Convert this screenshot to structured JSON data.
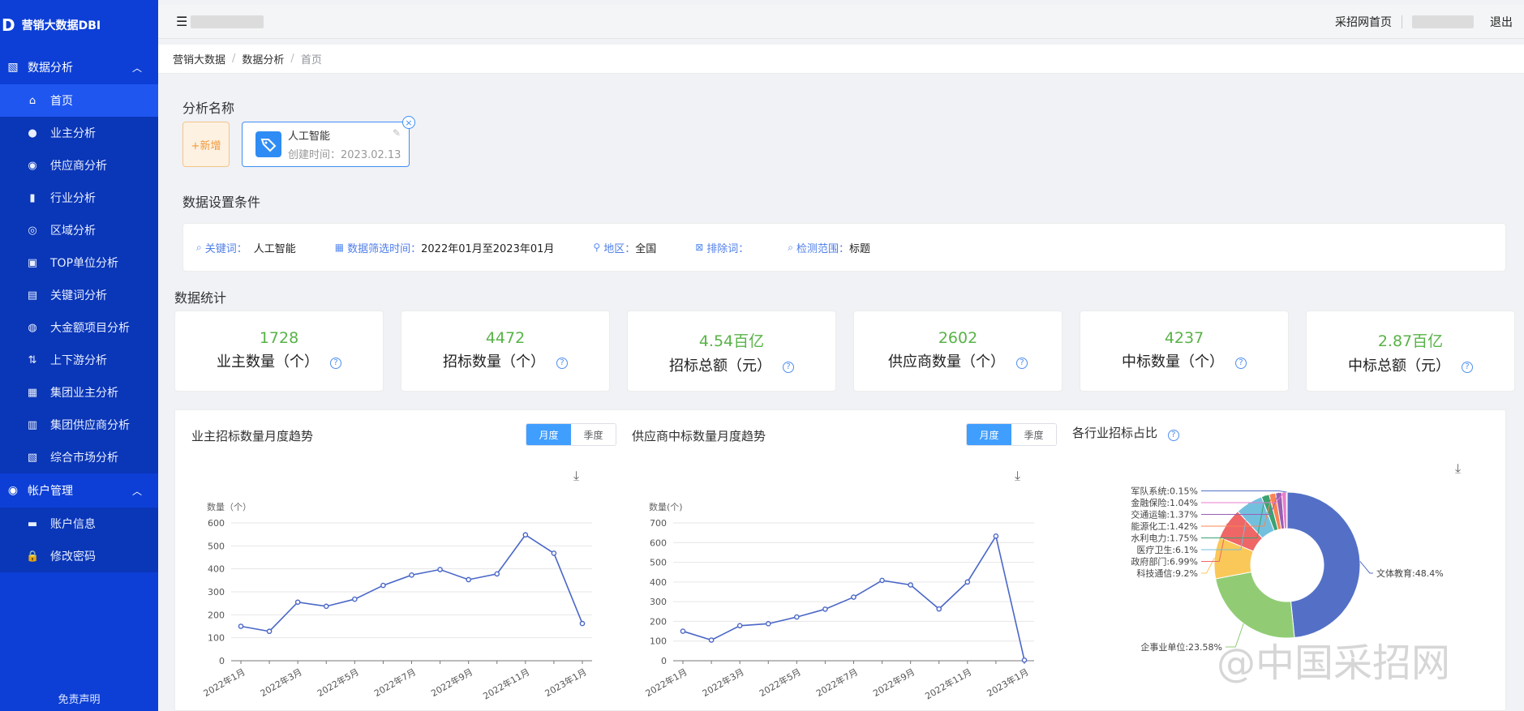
{
  "brand": {
    "logo": "D",
    "name": "营销大数据DBI"
  },
  "sidebar": {
    "group1": "数据分析",
    "items": [
      {
        "label": "首页",
        "icon": "home-icon",
        "glyph": "⌂"
      },
      {
        "label": "业主分析",
        "icon": "user-icon",
        "glyph": "●"
      },
      {
        "label": "供应商分析",
        "icon": "users-icon",
        "glyph": "◉"
      },
      {
        "label": "行业分析",
        "icon": "bar-chart-icon",
        "glyph": "▮"
      },
      {
        "label": "区域分析",
        "icon": "location-icon",
        "glyph": "◎"
      },
      {
        "label": "TOP单位分析",
        "icon": "top-icon",
        "glyph": "▣"
      },
      {
        "label": "关键词分析",
        "icon": "keyword-icon",
        "glyph": "▤"
      },
      {
        "label": "大金额项目分析",
        "icon": "money-bag-icon",
        "glyph": "◍"
      },
      {
        "label": "上下游分析",
        "icon": "updown-icon",
        "glyph": "⇅"
      },
      {
        "label": "集团业主分析",
        "icon": "id-card-icon",
        "glyph": "▦"
      },
      {
        "label": "集团供应商分析",
        "icon": "doc-icon",
        "glyph": "▥"
      },
      {
        "label": "综合市场分析",
        "icon": "report-icon",
        "glyph": "▧"
      }
    ],
    "group2": "帐户管理",
    "items2": [
      {
        "label": "账户信息",
        "icon": "message-icon",
        "glyph": "▬"
      },
      {
        "label": "修改密码",
        "icon": "lock-icon",
        "glyph": "🔒"
      }
    ],
    "disclaimer": "免责声明"
  },
  "header": {
    "home_link": "采招网首页",
    "logout": "退出"
  },
  "breadcrumb": [
    "营销大数据",
    "数据分析",
    "首页"
  ],
  "analysis": {
    "title": "分析名称",
    "add_label": "+新增",
    "card_name": "人工智能",
    "card_date": "创建时间：2023.02.13"
  },
  "filters": {
    "title": "数据设置条件",
    "keyword_label": "关键词：",
    "keyword_value": "人工智能",
    "time_label": "数据筛选时间：",
    "time_value": "2022年01月至2023年01月",
    "region_label": "地区：",
    "region_value": "全国",
    "exclude_label": "排除词：",
    "exclude_value": "",
    "scope_label": "检测范围：",
    "scope_value": "标题"
  },
  "stats": {
    "title": "数据统计",
    "cards": [
      {
        "value": "1728",
        "label": "业主数量（个）"
      },
      {
        "value": "4472",
        "label": "招标数量（个）"
      },
      {
        "value": "4.54百亿",
        "label": "招标总额（元）"
      },
      {
        "value": "2602",
        "label": "供应商数量（个）"
      },
      {
        "value": "4237",
        "label": "中标数量（个）"
      },
      {
        "value": "2.87百亿",
        "label": "中标总额（元）"
      }
    ]
  },
  "toggle": {
    "month": "月度",
    "quarter": "季度"
  },
  "chart_titles": {
    "owner": "业主招标数量月度趋势",
    "supplier": "供应商中标数量月度趋势",
    "industry": "各行业招标占比"
  },
  "watermark": "@中国采招网",
  "colors": {
    "sidebar": "#0d3fd6",
    "line": "#4a67c7",
    "accent": "#409eff",
    "stat_value": "#58b347"
  },
  "chart_data": [
    {
      "type": "line",
      "title": "业主招标数量月度趋势",
      "ylabel": "数量（个）",
      "ylim": [
        0,
        600
      ],
      "yticks": [
        0,
        100,
        200,
        300,
        400,
        500,
        600
      ],
      "x": [
        "2022年1月",
        "2022年2月",
        "2022年3月",
        "2022年4月",
        "2022年5月",
        "2022年6月",
        "2022年7月",
        "2022年8月",
        "2022年9月",
        "2022年10月",
        "2022年11月",
        "2022年12月",
        "2023年1月"
      ],
      "xtick_labels": [
        "2022年1月",
        "2022年3月",
        "2022年5月",
        "2022年7月",
        "2022年9月",
        "2022年11月",
        "2023年1月"
      ],
      "values": [
        150,
        128,
        255,
        237,
        268,
        328,
        373,
        397,
        353,
        378,
        548,
        468,
        162
      ]
    },
    {
      "type": "line",
      "title": "供应商中标数量月度趋势",
      "ylabel": "数量(个)",
      "ylim": [
        0,
        700
      ],
      "yticks": [
        0,
        100,
        200,
        300,
        400,
        500,
        600,
        700
      ],
      "x": [
        "2022年1月",
        "2022年2月",
        "2022年3月",
        "2022年4月",
        "2022年5月",
        "2022年6月",
        "2022年7月",
        "2022年8月",
        "2022年9月",
        "2022年10月",
        "2022年11月",
        "2022年12月",
        "2023年1月"
      ],
      "xtick_labels": [
        "2022年1月",
        "2022年3月",
        "2022年5月",
        "2022年7月",
        "2022年9月",
        "2022年11月",
        "2023年1月"
      ],
      "values": [
        150,
        105,
        178,
        188,
        222,
        262,
        323,
        408,
        385,
        263,
        400,
        633,
        3
      ]
    },
    {
      "type": "pie",
      "title": "各行业招标占比",
      "donut": true,
      "slices": [
        {
          "name": "文体教育",
          "label": "文体教育:48.4%",
          "value": 48.4,
          "color": "#5470c6"
        },
        {
          "name": "企事业单位",
          "label": "企事业单位:23.58%",
          "value": 23.58,
          "color": "#91cc75"
        },
        {
          "name": "科技通信",
          "label": "科技通信:9.2%",
          "value": 9.2,
          "color": "#fac858"
        },
        {
          "name": "政府部门",
          "label": "政府部门:6.99%",
          "value": 6.99,
          "color": "#ee6666"
        },
        {
          "name": "医疗卫生",
          "label": "医疗卫生:6.1%",
          "value": 6.1,
          "color": "#73c0de"
        },
        {
          "name": "水利电力",
          "label": "水利电力:1.75%",
          "value": 1.75,
          "color": "#3ba272"
        },
        {
          "name": "能源化工",
          "label": "能源化工:1.42%",
          "value": 1.42,
          "color": "#fc8452"
        },
        {
          "name": "交通运输",
          "label": "交通运输:1.37%",
          "value": 1.37,
          "color": "#9a60b4"
        },
        {
          "name": "金融保险",
          "label": "金融保险:1.04%",
          "value": 1.04,
          "color": "#ea7ccc"
        },
        {
          "name": "军队系统",
          "label": "军队系统:0.15%",
          "value": 0.15,
          "color": "#5470c6"
        }
      ]
    }
  ]
}
